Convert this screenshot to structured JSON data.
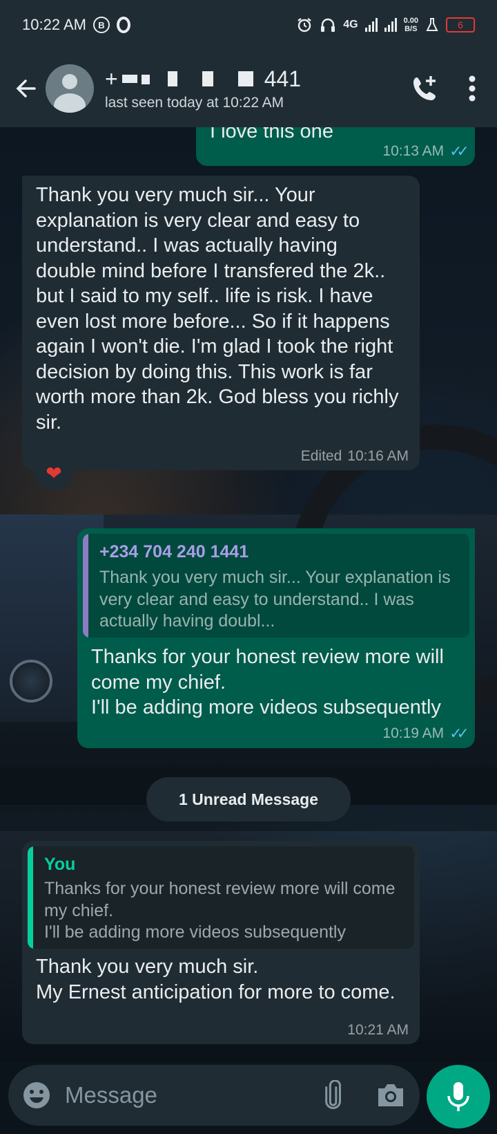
{
  "status": {
    "time": "10:22 AM",
    "network_label": "4G",
    "net_speed_value": "0.00",
    "net_speed_unit": "B/S",
    "battery_level": "6"
  },
  "header": {
    "contact_name_prefix": "+",
    "contact_name_suffix": "441",
    "last_seen": "last seen today at 10:22 AM"
  },
  "messages": [
    {
      "text": "I love this one",
      "time": "10:13 AM"
    },
    {
      "text": "Thank you very much sir... Your explanation is very clear and easy to understand.. I was actually having double mind before I transfered the 2k.. but I said to my self.. life is risk. I have even lost more before... So if it happens again I won't die. I'm glad I took the right decision by doing this. This work is far worth more than 2k. God bless you richly sir.",
      "edited_label": "Edited",
      "time": "10:16 AM",
      "reaction": "❤"
    },
    {
      "quote_name": "+234 704 240 1441",
      "quote_text": "Thank you very much sir... Your explanation is very clear and easy to understand.. I was actually having doubl...",
      "text": "Thanks for your honest review more will come my chief.\nI'll be adding more videos subsequently",
      "time": "10:19 AM"
    },
    {
      "quote_name": "You",
      "quote_text": "Thanks for your honest review more will come my chief.\nI'll be adding more videos subsequently",
      "text": "Thank you very much sir.\nMy Ernest anticipation for more to come.",
      "time": "10:21 AM"
    }
  ],
  "unread_label": "1 Unread Message",
  "input": {
    "placeholder": "Message"
  },
  "colors": {
    "incoming_bubble": "#202c33",
    "outgoing_bubble": "#005c4b",
    "accent_green": "#00a884",
    "quote_purple": "#8e7cc3",
    "quote_green": "#06cf9c",
    "read_ticks": "#53bdeb"
  }
}
